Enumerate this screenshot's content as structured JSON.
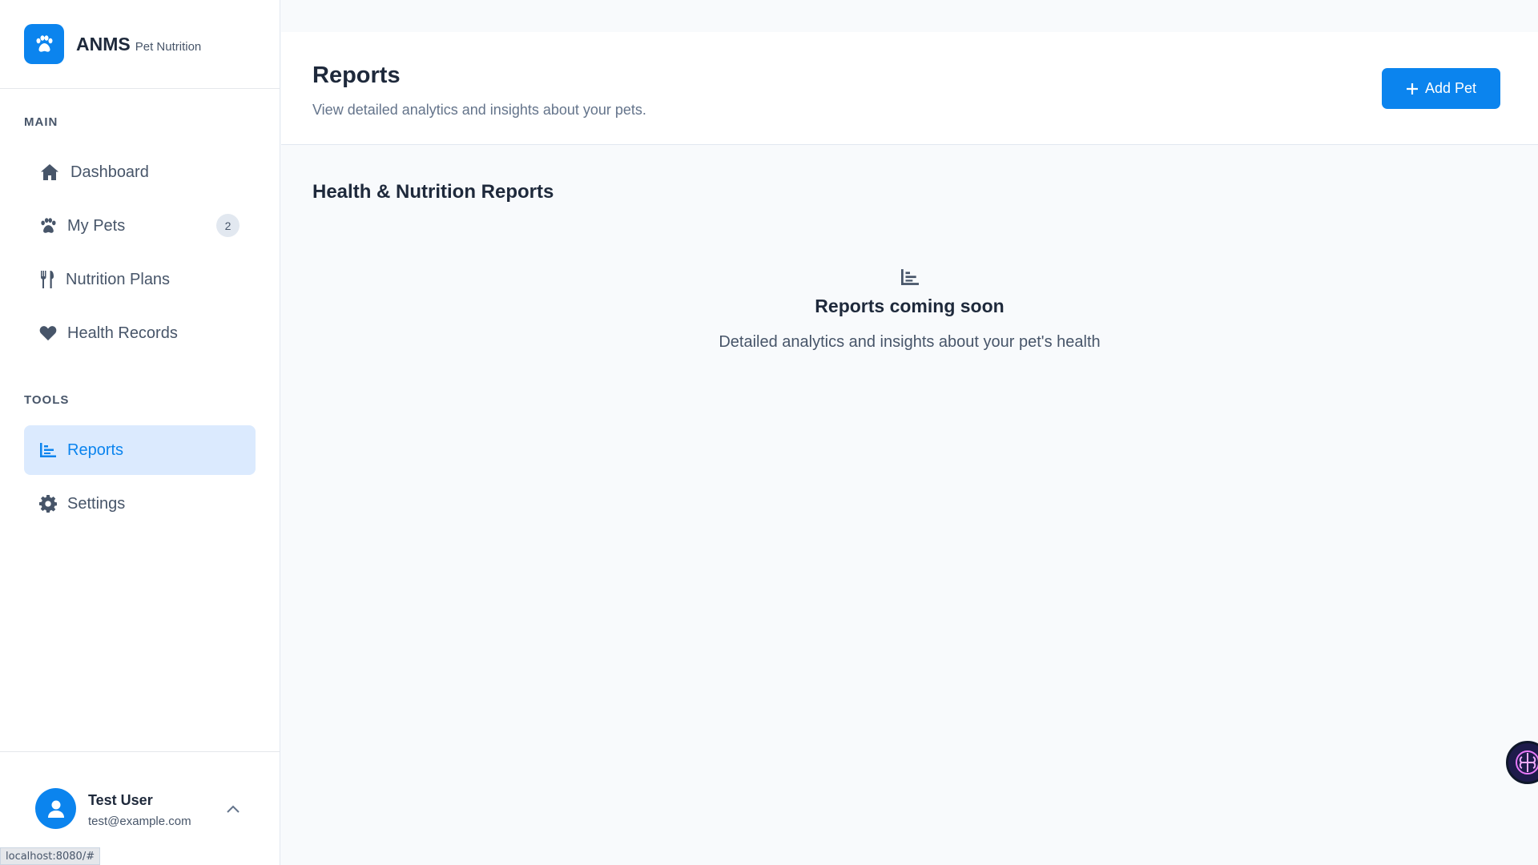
{
  "brand": {
    "name": "ANMS",
    "subtitle": "Pet Nutrition",
    "logo_icon": "paw-icon"
  },
  "sidebar": {
    "sections": [
      {
        "label": "MAIN"
      },
      {
        "label": "TOOLS"
      }
    ],
    "items": [
      {
        "label": "Dashboard",
        "icon": "home-icon"
      },
      {
        "label": "My Pets",
        "icon": "paw-icon",
        "badge": "2"
      },
      {
        "label": "Nutrition Plans",
        "icon": "utensils-icon"
      },
      {
        "label": "Health Records",
        "icon": "heart-icon"
      },
      {
        "label": "Reports",
        "icon": "chart-icon",
        "active": true
      },
      {
        "label": "Settings",
        "icon": "gear-icon"
      }
    ]
  },
  "user": {
    "name": "Test User",
    "email": "test@example.com"
  },
  "status_bar": {
    "url": "localhost:8080/#"
  },
  "header": {
    "title": "Reports",
    "subtitle": "View detailed analytics and insights about your pets.",
    "add_button_label": "Add Pet"
  },
  "main": {
    "section_title": "Health & Nutrition Reports",
    "empty_state": {
      "title": "Reports coming soon",
      "description": "Detailed analytics and insights about your pet's health"
    }
  },
  "colors": {
    "accent": "#0b84ee",
    "active_bg": "#dbeafe",
    "text_muted": "#475569"
  }
}
